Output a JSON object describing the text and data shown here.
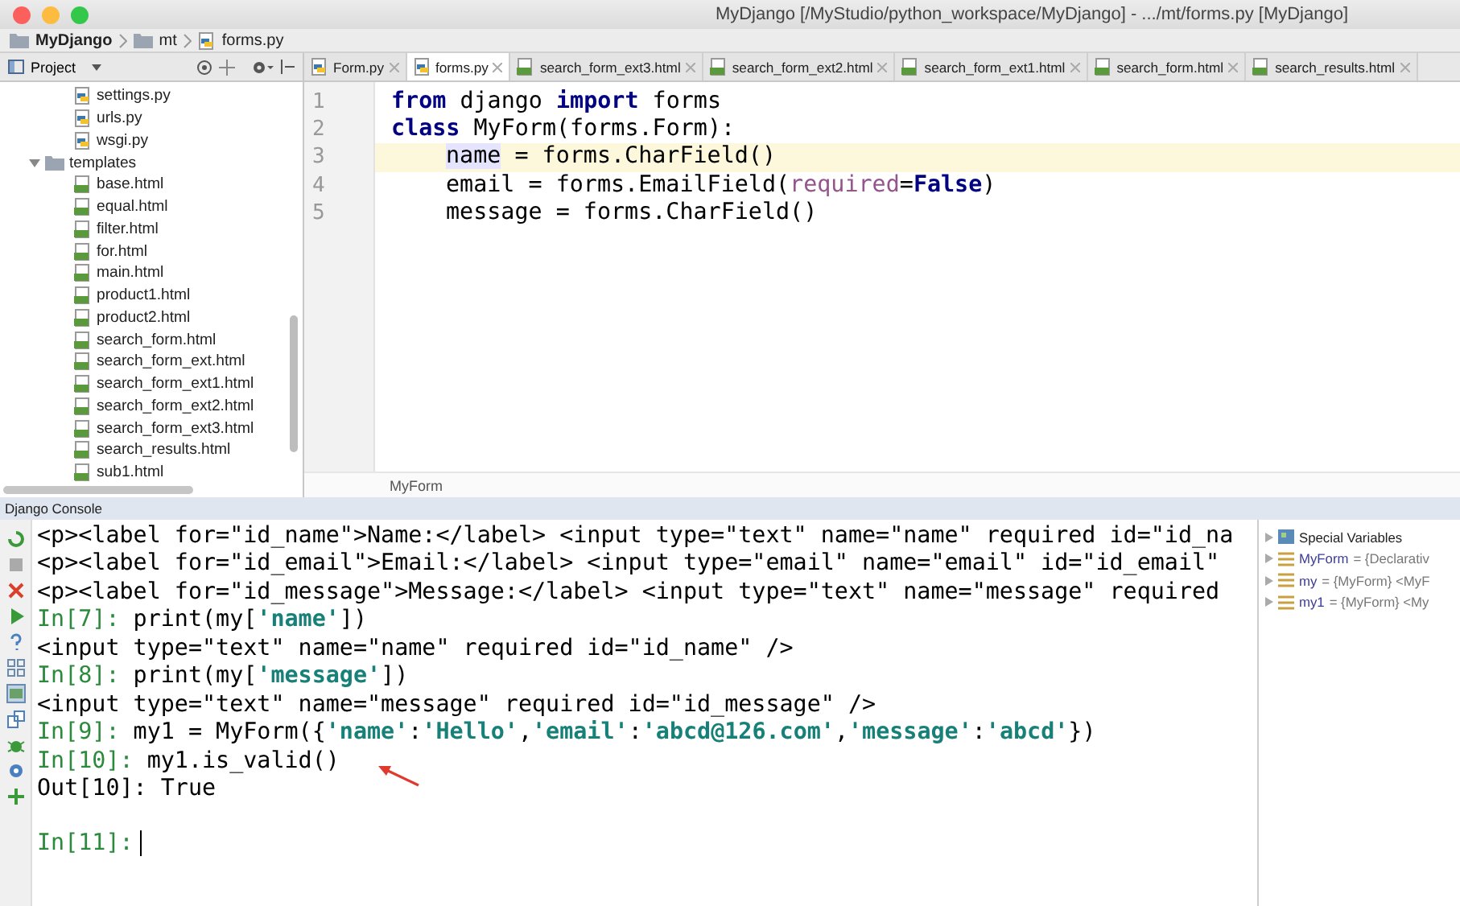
{
  "window": {
    "title": "MyDjango [/MyStudio/python_workspace/MyDjango] - .../mt/forms.py [MyDjango]"
  },
  "breadcrumb": [
    {
      "label": "MyDjango",
      "kind": "project"
    },
    {
      "label": "mt",
      "kind": "folder"
    },
    {
      "label": "forms.py",
      "kind": "python"
    }
  ],
  "project_panel": {
    "title": "Project",
    "tree": [
      {
        "label": "settings.py",
        "kind": "python"
      },
      {
        "label": "urls.py",
        "kind": "python"
      },
      {
        "label": "wsgi.py",
        "kind": "python"
      },
      {
        "label": "templates",
        "kind": "folder",
        "expanded": true,
        "children": [
          {
            "label": "base.html",
            "kind": "html"
          },
          {
            "label": "equal.html",
            "kind": "html"
          },
          {
            "label": "filter.html",
            "kind": "html"
          },
          {
            "label": "for.html",
            "kind": "html"
          },
          {
            "label": "main.html",
            "kind": "html"
          },
          {
            "label": "product1.html",
            "kind": "html"
          },
          {
            "label": "product2.html",
            "kind": "html"
          },
          {
            "label": "search_form.html",
            "kind": "html"
          },
          {
            "label": "search_form_ext.html",
            "kind": "html"
          },
          {
            "label": "search_form_ext1.html",
            "kind": "html"
          },
          {
            "label": "search_form_ext2.html",
            "kind": "html"
          },
          {
            "label": "search_form_ext3.html",
            "kind": "html"
          },
          {
            "label": "search_results.html",
            "kind": "html"
          },
          {
            "label": "sub1.html",
            "kind": "html"
          }
        ]
      }
    ]
  },
  "tabs": [
    {
      "label": "Form.py",
      "kind": "python",
      "selected": false
    },
    {
      "label": "forms.py",
      "kind": "python",
      "selected": true
    },
    {
      "label": "search_form_ext3.html",
      "kind": "html",
      "selected": false
    },
    {
      "label": "search_form_ext2.html",
      "kind": "html",
      "selected": false
    },
    {
      "label": "search_form_ext1.html",
      "kind": "html",
      "selected": false
    },
    {
      "label": "search_form.html",
      "kind": "html",
      "selected": false
    },
    {
      "label": "search_results.html",
      "kind": "html",
      "selected": false
    }
  ],
  "editor": {
    "lines": [
      {
        "number": "1",
        "current": false,
        "parts": [
          {
            "kind": "keyword",
            "text": "from"
          },
          {
            "kind": "plain",
            "text": " django "
          },
          {
            "kind": "keyword",
            "text": "import"
          },
          {
            "kind": "plain",
            "text": " forms"
          }
        ]
      },
      {
        "number": "2",
        "current": false,
        "parts": [
          {
            "kind": "keyword",
            "text": "class"
          },
          {
            "kind": "plain",
            "text": " MyForm(forms.Form):"
          }
        ]
      },
      {
        "number": "3",
        "current": true,
        "indented": true,
        "parts": [
          {
            "kind": "highlight",
            "text": "name"
          },
          {
            "kind": "plain",
            "text": " = forms.CharField()"
          }
        ]
      },
      {
        "number": "4",
        "current": false,
        "indented": true,
        "parts": [
          {
            "kind": "plain",
            "text": "email = forms.EmailField("
          },
          {
            "kind": "param",
            "text": "required"
          },
          {
            "kind": "plain",
            "text": "="
          },
          {
            "kind": "keyword",
            "text": "False"
          },
          {
            "kind": "plain",
            "text": ")"
          }
        ]
      },
      {
        "number": "5",
        "current": false,
        "indented": true,
        "parts": [
          {
            "kind": "plain",
            "text": "message = forms.CharField()"
          }
        ]
      }
    ],
    "breadcrumb": "MyForm"
  },
  "console": {
    "title": "Django Console",
    "lines": [
      {
        "parts": [
          {
            "kind": "text",
            "text": "<p><label for=\"id_name\">Name:</label> <input type=\"text\" name=\"name\" required id=\"id_na"
          }
        ]
      },
      {
        "parts": [
          {
            "kind": "text",
            "text": "<p><label for=\"id_email\">Email:</label> <input type=\"email\" name=\"email\" id=\"id_email\""
          }
        ]
      },
      {
        "parts": [
          {
            "kind": "text",
            "text": "<p><label for=\"id_message\">Message:</label> <input type=\"text\" name=\"message\" required"
          }
        ]
      },
      {
        "parts": [
          {
            "kind": "prompt",
            "text": "In[7]:"
          },
          {
            "kind": "text",
            "text": " print(my["
          },
          {
            "kind": "string",
            "text": "'name'"
          },
          {
            "kind": "text",
            "text": "])"
          }
        ]
      },
      {
        "parts": [
          {
            "kind": "text",
            "text": "<input type=\"text\" name=\"name\" required id=\"id_name\" />"
          }
        ]
      },
      {
        "parts": [
          {
            "kind": "prompt",
            "text": "In[8]:"
          },
          {
            "kind": "text",
            "text": " print(my["
          },
          {
            "kind": "string",
            "text": "'message'"
          },
          {
            "kind": "text",
            "text": "])"
          }
        ]
      },
      {
        "parts": [
          {
            "kind": "text",
            "text": "<input type=\"text\" name=\"message\" required id=\"id_message\" />"
          }
        ]
      },
      {
        "parts": [
          {
            "kind": "prompt",
            "text": "In[9]:"
          },
          {
            "kind": "text",
            "text": " my1 = MyForm({"
          },
          {
            "kind": "string",
            "text": "'name'"
          },
          {
            "kind": "text",
            "text": ":"
          },
          {
            "kind": "string",
            "text": "'Hello'"
          },
          {
            "kind": "text",
            "text": ","
          },
          {
            "kind": "string",
            "text": "'email'"
          },
          {
            "kind": "text",
            "text": ":"
          },
          {
            "kind": "string",
            "text": "'abcd@126.com'"
          },
          {
            "kind": "text",
            "text": ","
          },
          {
            "kind": "string",
            "text": "'message'"
          },
          {
            "kind": "text",
            "text": ":"
          },
          {
            "kind": "string",
            "text": "'abcd'"
          },
          {
            "kind": "text",
            "text": "})"
          }
        ]
      },
      {
        "parts": [
          {
            "kind": "prompt",
            "text": "In[10]:"
          },
          {
            "kind": "text",
            "text": " my1.is_valid()"
          }
        ]
      },
      {
        "parts": [
          {
            "kind": "text",
            "text": "Out[10]: True"
          }
        ]
      }
    ],
    "input_prompt": "In[11]:",
    "variables": [
      {
        "kind": "special",
        "name": "Special Variables"
      },
      {
        "kind": "var",
        "name": "MyForm",
        "value": "= {Declarativ"
      },
      {
        "kind": "var",
        "name": "my",
        "value": "= {MyForm} <MyF"
      },
      {
        "kind": "var",
        "name": "my1",
        "value": "= {MyForm} <My"
      }
    ]
  }
}
